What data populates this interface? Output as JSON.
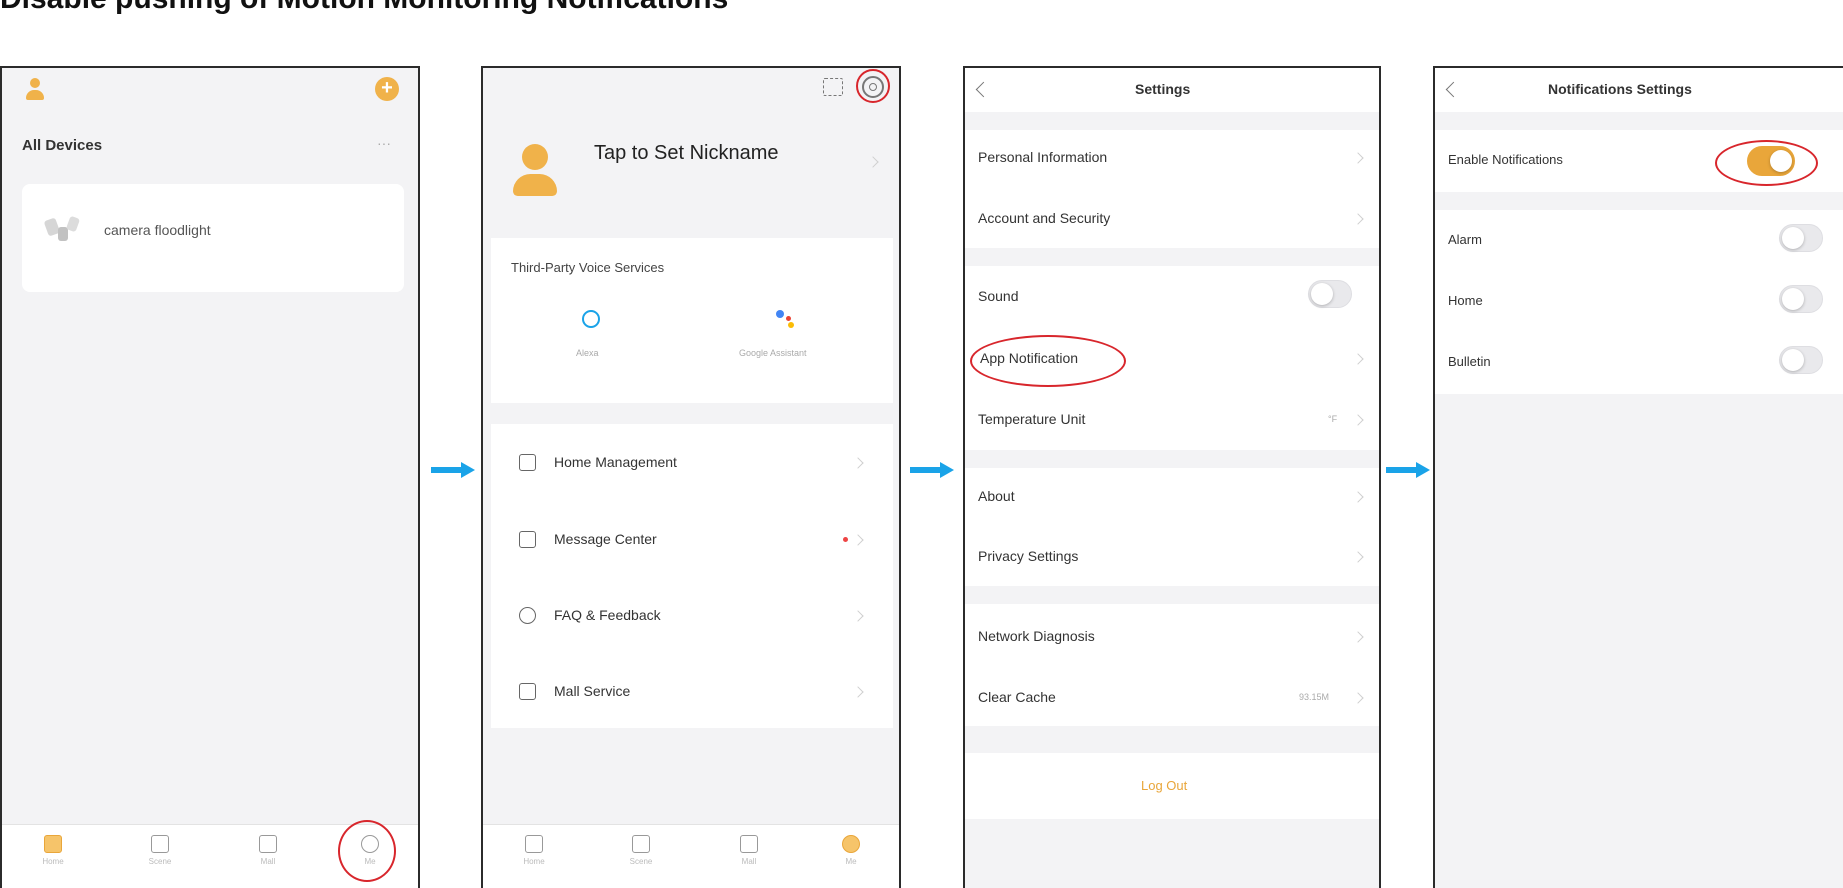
{
  "page_title": "Disable pushing of Motion Monitoring Notifications",
  "screen1": {
    "header": "All Devices",
    "more": "···",
    "device_name": "camera floodlight",
    "tabs": [
      "Home",
      "Scene",
      "Mall",
      "Me"
    ]
  },
  "screen2": {
    "nickname": "Tap to Set Nickname",
    "voice_header": "Third-Party Voice Services",
    "voice_services": [
      "Alexa",
      "Google Assistant"
    ],
    "menu": [
      "Home Management",
      "Message Center",
      "FAQ & Feedback",
      "Mall Service"
    ],
    "tabs": [
      "Home",
      "Scene",
      "Mall",
      "Me"
    ]
  },
  "screen3": {
    "title": "Settings",
    "items": {
      "personal": "Personal Information",
      "account": "Account and Security",
      "sound": "Sound",
      "app_notification": "App Notification",
      "temperature": "Temperature Unit",
      "temperature_value": "°F",
      "about": "About",
      "privacy": "Privacy Settings",
      "network": "Network Diagnosis",
      "cache": "Clear Cache",
      "cache_value": "93.15M",
      "logout": "Log Out"
    },
    "sound_on": false
  },
  "screen4": {
    "title": "Notifications Settings",
    "enable_label": "Enable Notifications",
    "enable_on": true,
    "items": [
      "Alarm",
      "Home",
      "Bulletin"
    ]
  },
  "colors": {
    "accent": "#e9a63a",
    "highlight": "#d8262c",
    "arrow": "#1aa3e8"
  }
}
